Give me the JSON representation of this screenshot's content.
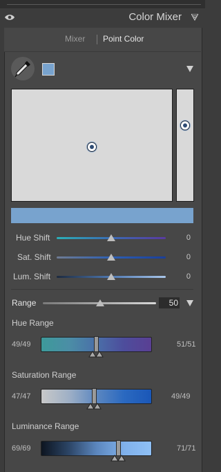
{
  "panel": {
    "title": "Color Mixer"
  },
  "tabs": {
    "mixer": "Mixer",
    "point_color": "Point Color",
    "active": "Point Color"
  },
  "sample": {
    "swatch_color": "#78a3ce"
  },
  "sliders": [
    {
      "label": "Hue Shift",
      "value": "0",
      "level": 0.5
    },
    {
      "label": "Sat. Shift",
      "value": "0",
      "level": 0.5
    },
    {
      "label": "Lum. Shift",
      "value": "0",
      "level": 0.5
    }
  ],
  "range": {
    "label": "Range",
    "value": "50",
    "level": 0.5
  },
  "hue_range": {
    "label": "Hue Range",
    "left": "49/49",
    "right": "51/51"
  },
  "saturation_range": {
    "label": "Saturation Range",
    "left": "47/47",
    "right": "49/49"
  },
  "luminance_range": {
    "label": "Luminance Range",
    "left": "69/69",
    "right": "71/71"
  },
  "colors": {
    "accent": "#78a3ce",
    "panel": "#474747",
    "background": "#3c3c3c"
  }
}
